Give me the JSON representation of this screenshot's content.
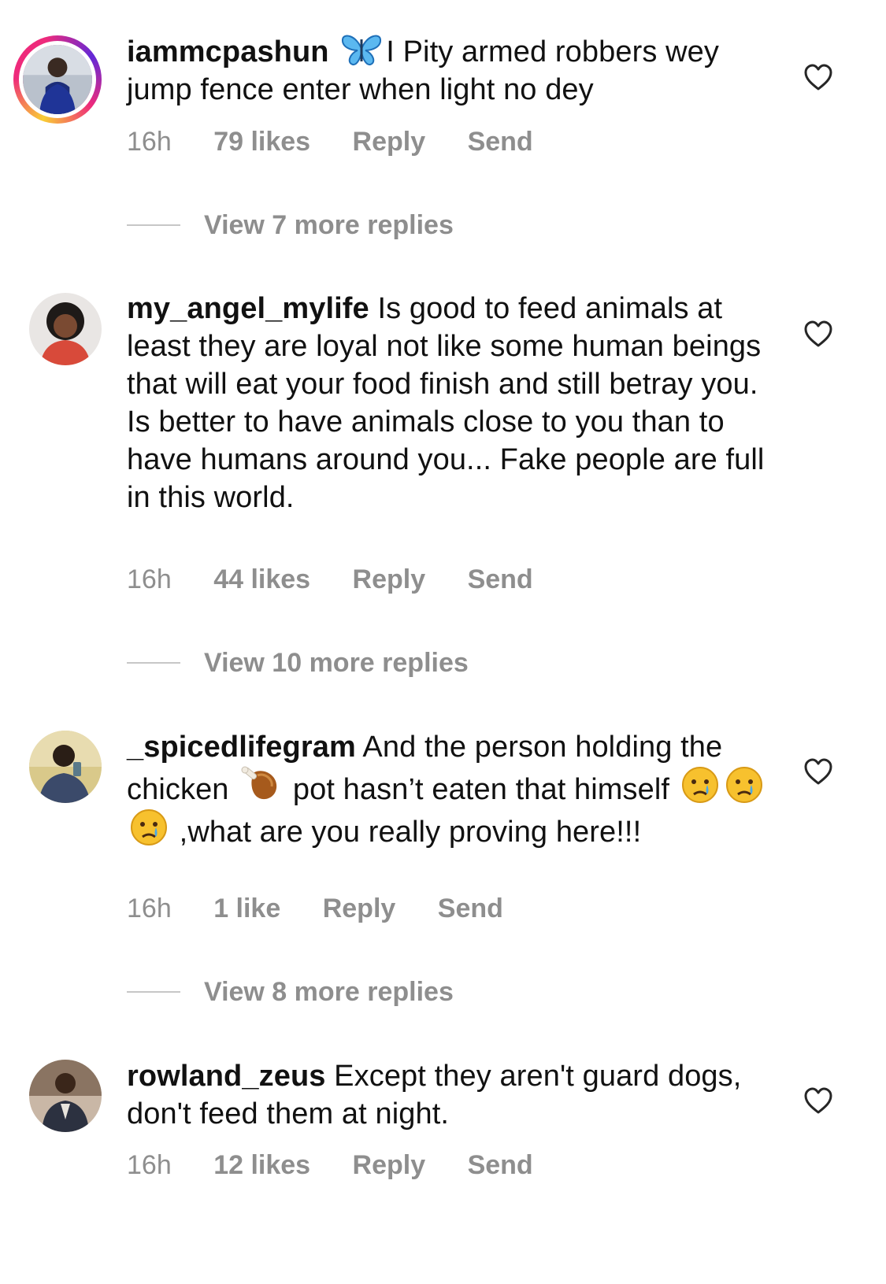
{
  "comments": [
    {
      "username": "iammcpashun",
      "text_pre_emoji": "",
      "text": "I Pity armed robbers wey jump fence enter when light no dey",
      "time": "16h",
      "likes": "79 likes",
      "reply": "Reply",
      "send": "Send",
      "view_replies": "View 7 more replies"
    },
    {
      "username": "my_angel_mylife",
      "text": "Is good to feed animals at least they are loyal not like some human beings that will eat your food finish and still betray you. Is better to have animals close to you than to have humans around you... Fake people are full in this world.",
      "time": "16h",
      "likes": "44 likes",
      "reply": "Reply",
      "send": "Send",
      "view_replies": "View 10 more replies"
    },
    {
      "username": "_spicedlifegram",
      "text_part1": "And the person holding the chicken",
      "text_part2": "pot hasn’t eaten that himself",
      "text_part3": ",what are you really proving here!!!",
      "time": "16h",
      "likes": "1 like",
      "reply": "Reply",
      "send": "Send",
      "view_replies": "View 8 more replies"
    },
    {
      "username": "rowland_zeus",
      "text": "Except they aren't guard dogs, don't feed them at night.",
      "time": "16h",
      "likes": "12 likes",
      "reply": "Reply",
      "send": "Send"
    }
  ],
  "icons": {
    "heart": "heart-outline-icon",
    "butterfly": "butterfly-emoji",
    "drumstick": "poultry-leg-emoji",
    "crying": "crying-face-emoji"
  },
  "colors": {
    "meta_text": "#8e8e8e",
    "story_ring": "#ee2a7b"
  }
}
